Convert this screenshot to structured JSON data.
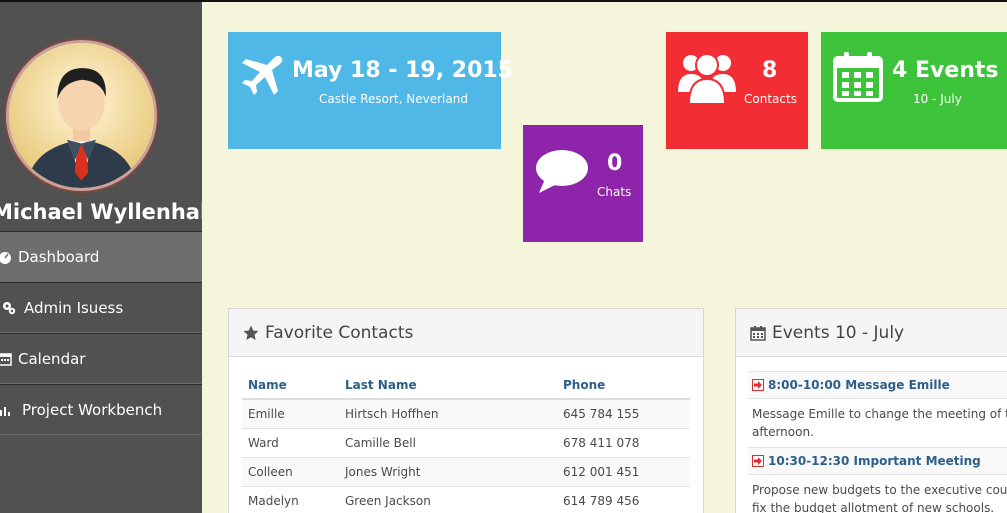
{
  "sidebar": {
    "user_name": "Michael Wyllenhal",
    "items": [
      {
        "label": "Dashboard",
        "icon": "dashboard-icon",
        "active": true
      },
      {
        "label": "Admin Isuess",
        "icon": "cogs-icon",
        "active": false
      },
      {
        "label": "Calendar",
        "icon": "calendar-icon",
        "active": false
      },
      {
        "label": "Project Workbench",
        "icon": "bar-chart-icon",
        "active": false
      }
    ]
  },
  "tiles": {
    "date": {
      "title": "May 18 - 19, 2015",
      "subtitle": "Castle Resort, Neverland",
      "icon": "plane-icon",
      "color": "#4fb8e6"
    },
    "chats": {
      "value": "0",
      "label": "Chats",
      "icon": "comment-icon",
      "color": "#8e24aa"
    },
    "contacts": {
      "value": "8",
      "label": "Contacts",
      "icon": "users-icon",
      "color": "#f22e34"
    },
    "events": {
      "value": "4 Events",
      "label": "10 - July",
      "icon": "calendar-icon",
      "color": "#3cc33a"
    }
  },
  "favorite_contacts": {
    "title": "Favorite Contacts",
    "icon": "star-icon",
    "columns": [
      "Name",
      "Last Name",
      "Phone"
    ],
    "rows": [
      [
        "Emille",
        "Hirtsch Hoffhen",
        "645 784 155"
      ],
      [
        "Ward",
        "Camille Bell",
        "678 411 078"
      ],
      [
        "Colleen",
        "Jones Wright",
        "612 001 451"
      ],
      [
        "Madelyn",
        "Green Jackson",
        "614 789 456"
      ]
    ]
  },
  "events_panel": {
    "title": "Events 10 - July",
    "icon": "calendar-icon",
    "items": [
      {
        "title": "8:00-10:00 Message Emille",
        "body_lines": [
          "Message Emille to change the meeting of tor",
          "afternoon."
        ]
      },
      {
        "title": "10:30-12:30 Important Meeting",
        "body_lines": [
          "Propose new budgets to the executive counc",
          "fix the budget allotment of new schools."
        ]
      }
    ]
  }
}
